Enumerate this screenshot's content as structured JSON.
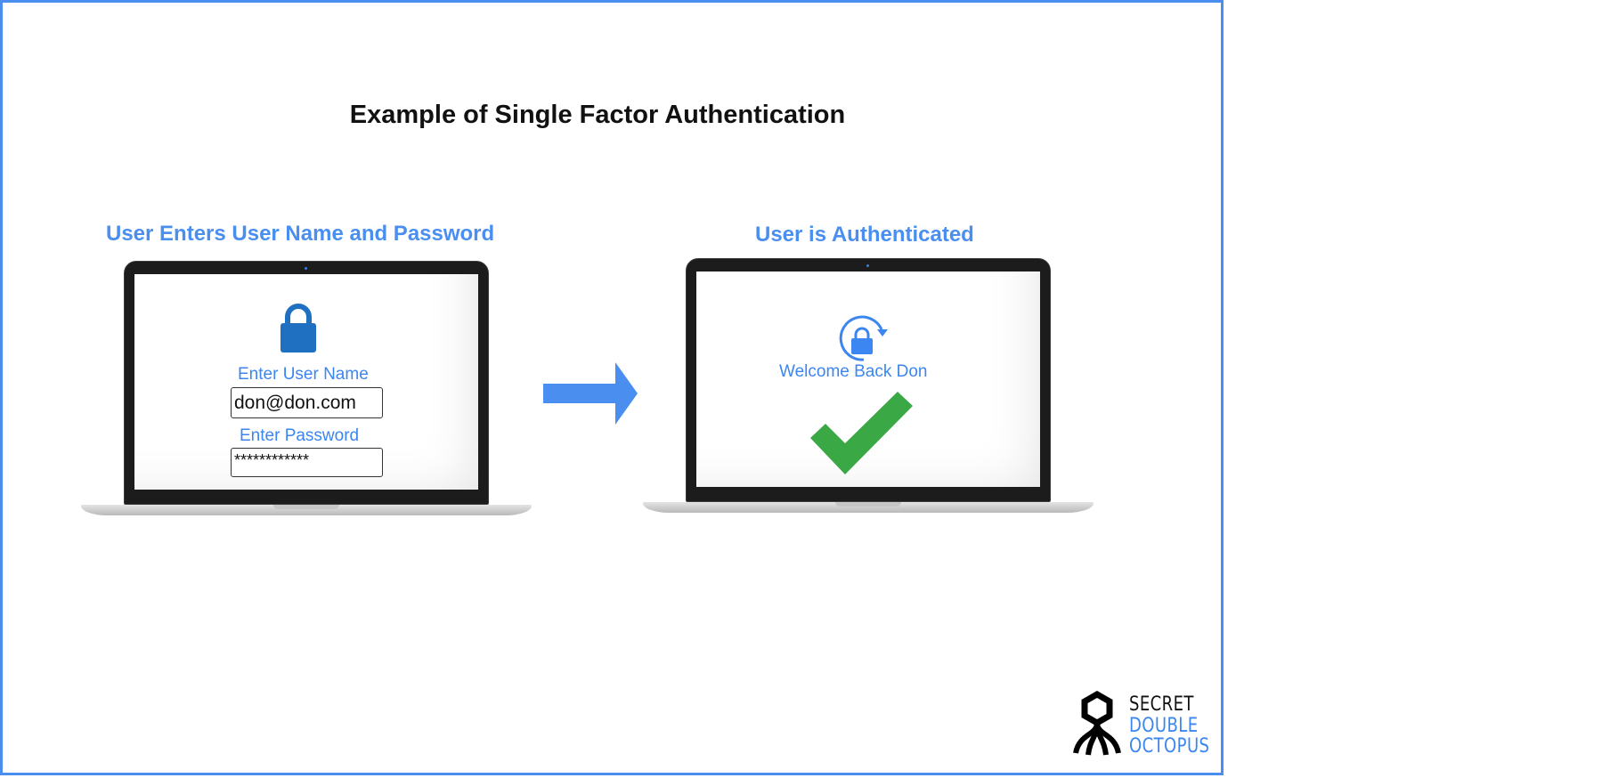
{
  "title": "Example of Single Factor Authentication",
  "left_panel": {
    "caption": "User Enters  User Name and Password",
    "username_label": "Enter User Name",
    "username_value": "don@don.com",
    "password_label": "Enter Password",
    "password_value": "************",
    "icon": "padlock-icon"
  },
  "right_panel": {
    "caption": "User is Authenticated",
    "welcome_text": "Welcome Back Don",
    "icons": [
      "lock-refresh-icon",
      "checkmark-icon"
    ]
  },
  "flow_arrow": "right-arrow-icon",
  "logo": {
    "line1": "SECRET",
    "line2": "DOUBLE",
    "line3": "OCTOPUS"
  },
  "colors": {
    "accent_blue": "#4a8ff0",
    "lock_blue": "#1f70c0",
    "check_green": "#3aa845",
    "title_text": "#111111"
  }
}
